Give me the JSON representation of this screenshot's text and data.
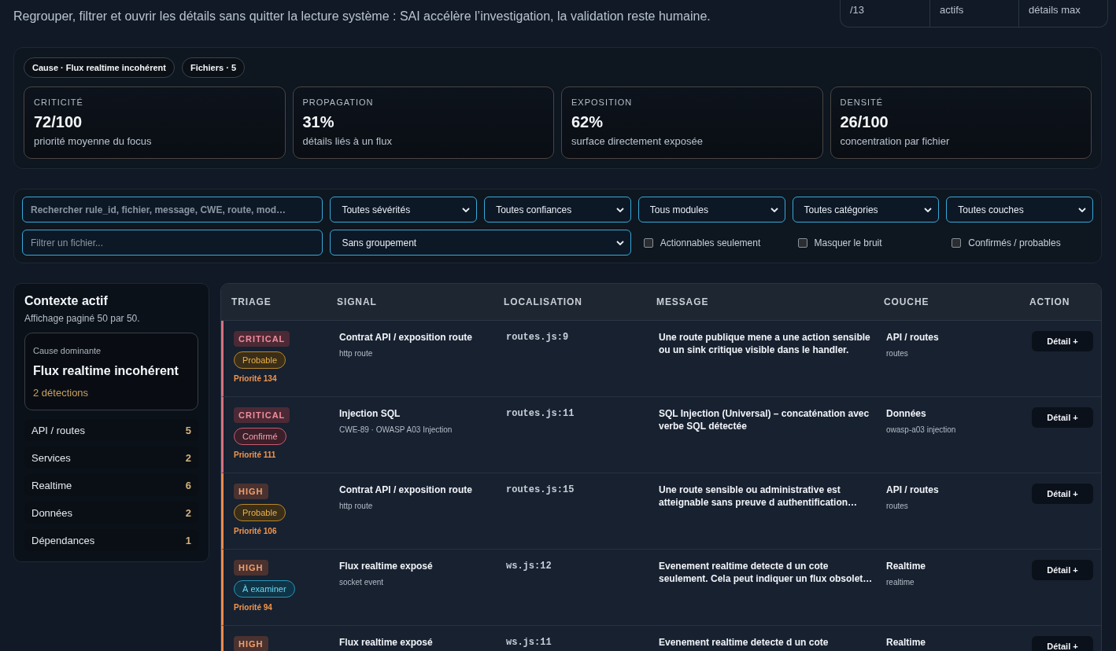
{
  "header": {
    "subtitle": "Regrouper, filtrer et ouvrir les détails sans quitter la lecture système : SAI accélère l’investigation, la validation reste humaine.",
    "stats": [
      "/13",
      "actifs",
      "détails max"
    ]
  },
  "summary": {
    "chips": [
      "Cause · Flux realtime incohérent",
      "Fichiers · 5"
    ],
    "metrics": [
      {
        "label": "CRITICITÉ",
        "value": "72/100",
        "caption": "priorité moyenne du focus"
      },
      {
        "label": "PROPAGATION",
        "value": "31%",
        "caption": "détails liés à un flux"
      },
      {
        "label": "EXPOSITION",
        "value": "62%",
        "caption": "surface directement exposée"
      },
      {
        "label": "DENSITÉ",
        "value": "26/100",
        "caption": "concentration par fichier"
      }
    ]
  },
  "filters": {
    "search": {
      "placeholder": "Rechercher rule_id, fichier, message, CWE, route, mod…"
    },
    "selects": [
      {
        "value": "Toutes sévérités"
      },
      {
        "value": "Toutes confiances"
      },
      {
        "value": "Tous modules"
      },
      {
        "value": "Toutes catégories"
      },
      {
        "value": "Toutes couches"
      }
    ],
    "file_filter": {
      "placeholder": "Filtrer un fichier..."
    },
    "grouping": {
      "value": "Sans groupement"
    },
    "toggles": [
      {
        "label": "Actionnables seulement",
        "checked": false
      },
      {
        "label": "Masquer le bruit",
        "checked": false
      },
      {
        "label": "Confirmés / probables",
        "checked": false
      }
    ]
  },
  "sidebar": {
    "title": "Contexte actif",
    "subtitle": "Affichage paginé 50 par 50.",
    "cause": {
      "label": "Cause dominante",
      "title": "Flux realtime incohérent",
      "count": "2 détections"
    },
    "layers": [
      {
        "name": "API / routes",
        "count": "5"
      },
      {
        "name": "Services",
        "count": "2"
      },
      {
        "name": "Realtime",
        "count": "6"
      },
      {
        "name": "Données",
        "count": "2"
      },
      {
        "name": "Dépendances",
        "count": "1"
      }
    ]
  },
  "table": {
    "columns": [
      "TRIAGE",
      "SIGNAL",
      "LOCALISATION",
      "MESSAGE",
      "COUCHE",
      "ACTION"
    ],
    "rows": [
      {
        "severity": {
          "label": "CRITICAL",
          "kind": "critical"
        },
        "confidence": {
          "label": "Probable",
          "kind": "probable"
        },
        "priority": "Priorité 134",
        "signal": {
          "title": "Contrat API / exposition route",
          "detail": "http route"
        },
        "location": "routes.js:9",
        "message": "Une route publique mene a une action sensible ou un sink critique visible dans le handler.",
        "layer": {
          "title": "API / routes",
          "detail": "routes"
        },
        "action": "Détail +"
      },
      {
        "severity": {
          "label": "CRITICAL",
          "kind": "critical"
        },
        "confidence": {
          "label": "Confirmé",
          "kind": "confirmed"
        },
        "priority": "Priorité 111",
        "signal": {
          "title": "Injection SQL",
          "detail": "CWE-89 · OWASP A03 Injection"
        },
        "location": "routes.js:11",
        "message": "SQL Injection (Universal) – concaténation avec verbe SQL détectée",
        "layer": {
          "title": "Données",
          "detail": "owasp-a03 injection"
        },
        "action": "Détail +"
      },
      {
        "severity": {
          "label": "HIGH",
          "kind": "high"
        },
        "confidence": {
          "label": "Probable",
          "kind": "probable"
        },
        "priority": "Priorité 106",
        "signal": {
          "title": "Contrat API / exposition route",
          "detail": "http route"
        },
        "location": "routes.js:15",
        "message": "Une route sensible ou administrative est atteignable sans preuve d authentification…",
        "layer": {
          "title": "API / routes",
          "detail": "routes"
        },
        "action": "Détail +"
      },
      {
        "severity": {
          "label": "HIGH",
          "kind": "high"
        },
        "confidence": {
          "label": "À examiner",
          "kind": "review"
        },
        "priority": "Priorité 94",
        "signal": {
          "title": "Flux realtime exposé",
          "detail": "socket event"
        },
        "location": "ws.js:12",
        "message": "Evenement realtime detecte d un cote seulement. Cela peut indiquer un flux obsolet…",
        "layer": {
          "title": "Realtime",
          "detail": "realtime"
        },
        "action": "Détail +"
      },
      {
        "severity": {
          "label": "HIGH",
          "kind": "high"
        },
        "signal": {
          "title": "Flux realtime exposé"
        },
        "location": "ws.js:11",
        "message": "Evenement realtime detecte d un cote",
        "layer": {
          "title": "Realtime"
        },
        "action": "Détail +"
      }
    ]
  }
}
